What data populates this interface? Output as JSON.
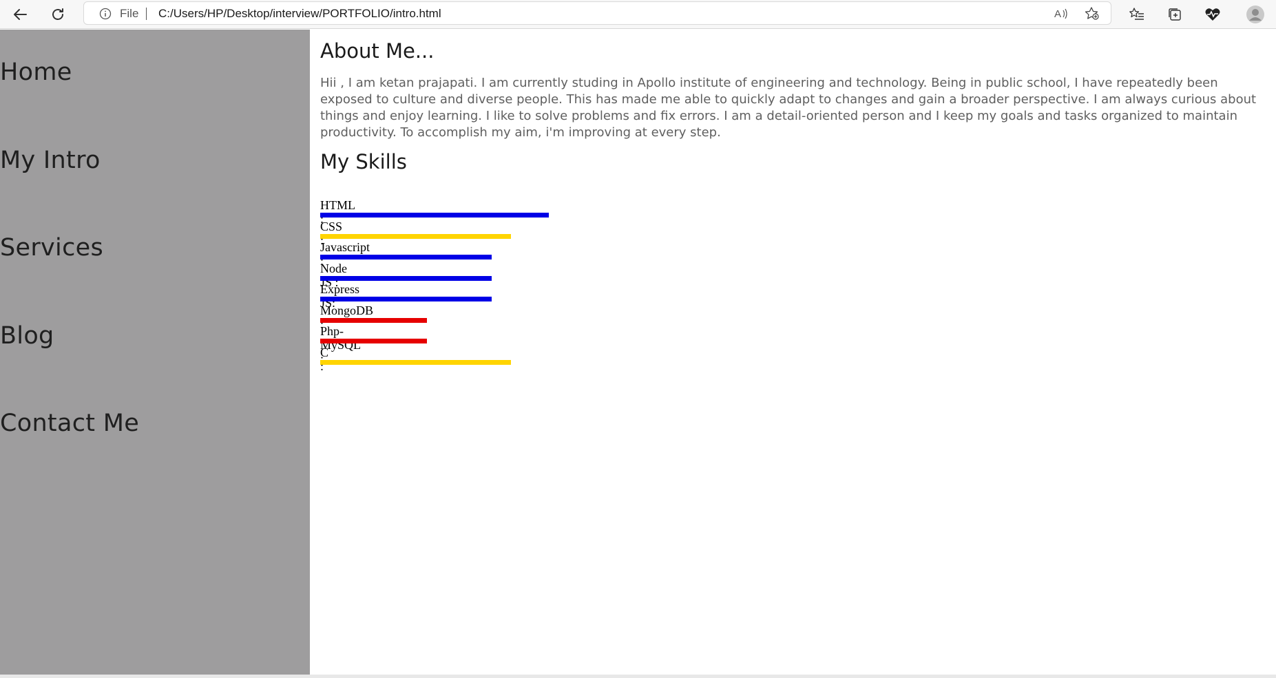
{
  "browser": {
    "address_prefix": "File",
    "url": "C:/Users/HP/Desktop/interview/PORTFOLIO/intro.html",
    "icons": [
      "back-arrow-icon",
      "refresh-icon",
      "info-icon",
      "read-aloud-icon",
      "add-favorite-icon",
      "favorites-icon",
      "collections-icon",
      "health-icon",
      "profile-icon"
    ]
  },
  "sidebar": {
    "items": [
      {
        "label": "Home"
      },
      {
        "label": "My Intro"
      },
      {
        "label": "Services"
      },
      {
        "label": "Blog"
      },
      {
        "label": "Contact Me"
      }
    ]
  },
  "about": {
    "heading": "About Me...",
    "text": "Hii , I am ketan prajapati. I am currently studing in Apollo institute of engineering and technology. Being in public school, I have repeatedly been exposed to culture and diverse people. This has made me able to quickly adapt to changes and gain a broader perspective. I am always curious about things and enjoy learning. I like to solve problems and fix errors. I am a detail-oriented person and I keep my goals and tasks organized to maintain productivity. To accomplish my aim, i'm improving at every step."
  },
  "skills": {
    "heading": "My Skills",
    "items": [
      {
        "label": "HTML :",
        "level": 0.6,
        "color": "#0000e6"
      },
      {
        "label": "CSS :",
        "level": 0.5,
        "color": "#ffd400"
      },
      {
        "label": "Javascript :",
        "level": 0.45,
        "color": "#0000e6"
      },
      {
        "label": "Node JS :",
        "level": 0.45,
        "color": "#0000e6"
      },
      {
        "label": "Express JS:",
        "level": 0.45,
        "color": "#0000e6"
      },
      {
        "label": "MongoDB :",
        "level": 0.28,
        "color": "#e60000"
      },
      {
        "label": "Php-MySQL :",
        "level": 0.28,
        "color": "#e60000"
      },
      {
        "label": "C :",
        "level": 0.5,
        "color": "#ffd400"
      }
    ]
  },
  "colors": {
    "sidebar_bg": "#9e9d9e",
    "page_bg": "#ffffff"
  }
}
